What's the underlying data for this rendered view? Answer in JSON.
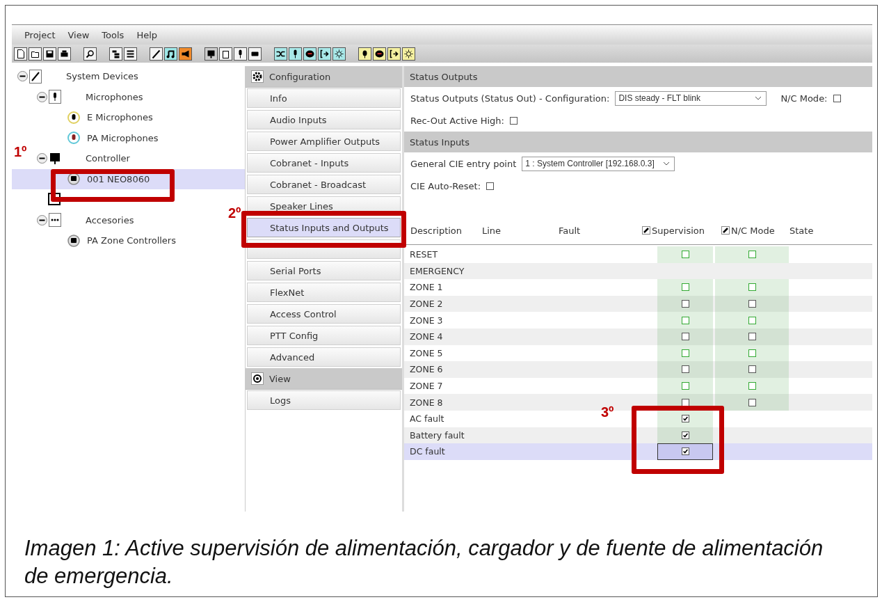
{
  "menu": [
    "Project",
    "View",
    "Tools",
    "Help"
  ],
  "tree": [
    {
      "label": "System Devices",
      "expanded": true,
      "selected": false,
      "children": [
        {
          "label": "Microphones",
          "expanded": true,
          "selected": false,
          "children": [
            {
              "label": "E Microphones",
              "selected": false
            },
            {
              "label": "PA Microphones",
              "selected": false
            }
          ]
        },
        {
          "label": "Controller",
          "expanded": true,
          "selected": false,
          "children": [
            {
              "label": "001 NEO8060",
              "selected": true
            }
          ]
        },
        {
          "selected": false
        },
        {
          "label": "Accesories",
          "expanded": true,
          "selected": false,
          "children": [
            {
              "label": "PA Zone Controllers",
              "selected": false
            }
          ]
        }
      ]
    }
  ],
  "nav": [
    {
      "kind": "header",
      "label": "Configuration"
    },
    {
      "kind": "item",
      "label": "Info",
      "selected": false
    },
    {
      "kind": "item",
      "label": "Audio Inputs",
      "selected": false
    },
    {
      "kind": "item",
      "label": "Power Amplifier Outputs",
      "selected": false
    },
    {
      "kind": "item",
      "label": "Cobranet - Inputs",
      "selected": false
    },
    {
      "kind": "item",
      "label": "Cobranet - Broadcast",
      "selected": false
    },
    {
      "kind": "item",
      "label": "Speaker Lines",
      "selected": false
    },
    {
      "kind": "item",
      "label": "Status Inputs and Outputs",
      "selected": true
    },
    {
      "kind": "item",
      "selected": false
    },
    {
      "kind": "item",
      "label": "Serial Ports",
      "selected": false
    },
    {
      "kind": "item",
      "label": "FlexNet",
      "selected": false
    },
    {
      "kind": "item",
      "label": "Access Control",
      "selected": false
    },
    {
      "kind": "item",
      "label": "PTT Config",
      "selected": false
    },
    {
      "kind": "item",
      "label": "Advanced",
      "selected": false
    },
    {
      "kind": "header",
      "label": "View"
    },
    {
      "kind": "item",
      "label": "Logs",
      "selected": false
    }
  ],
  "status_outputs": {
    "title": "Status Outputs",
    "config_label": "Status Outputs (Status Out)  -  Configuration:",
    "config_value": "DIS steady - FLT blink",
    "nc_label": "N/C Mode:",
    "nc_checked": false,
    "rec_label": "Rec-Out Active High:",
    "rec_checked": false
  },
  "status_inputs": {
    "title": "Status Inputs",
    "entry_label": "General CIE entry point",
    "entry_value": "1 : System Controller [192.168.0.3]",
    "autoreset_label": "CIE Auto-Reset:",
    "autoreset_checked": false,
    "columns": [
      "Description",
      "Line",
      "Fault",
      "Supervision",
      "N/C Mode",
      "State"
    ],
    "rows": [
      {
        "description": "RESET",
        "supervision": false,
        "nc_mode": false,
        "selected": false
      },
      {
        "description": "EMERGENCY",
        "selected": false
      },
      {
        "description": "ZONE 1",
        "supervision": false,
        "nc_mode": false,
        "selected": false
      },
      {
        "description": "ZONE 2",
        "supervision": false,
        "nc_mode": false,
        "selected": false
      },
      {
        "description": "ZONE 3",
        "supervision": false,
        "nc_mode": false,
        "selected": false
      },
      {
        "description": "ZONE 4",
        "supervision": false,
        "nc_mode": false,
        "selected": false
      },
      {
        "description": "ZONE 5",
        "supervision": false,
        "nc_mode": false,
        "selected": false
      },
      {
        "description": "ZONE 6",
        "supervision": false,
        "nc_mode": false,
        "selected": false
      },
      {
        "description": "ZONE 7",
        "supervision": false,
        "nc_mode": false,
        "selected": false
      },
      {
        "description": "ZONE 8",
        "supervision": false,
        "nc_mode": false,
        "selected": false
      },
      {
        "description": "AC fault",
        "supervision": true,
        "selected": false
      },
      {
        "description": "Battery fault",
        "supervision": true,
        "selected": false
      },
      {
        "description": "DC fault",
        "supervision": true,
        "selected": true
      }
    ]
  },
  "annotations": [
    "1º",
    "2º",
    "3º"
  ],
  "caption": "Imagen 1: Active supervisión de alimentación, cargador y de fuente de alimentación de emergencia."
}
